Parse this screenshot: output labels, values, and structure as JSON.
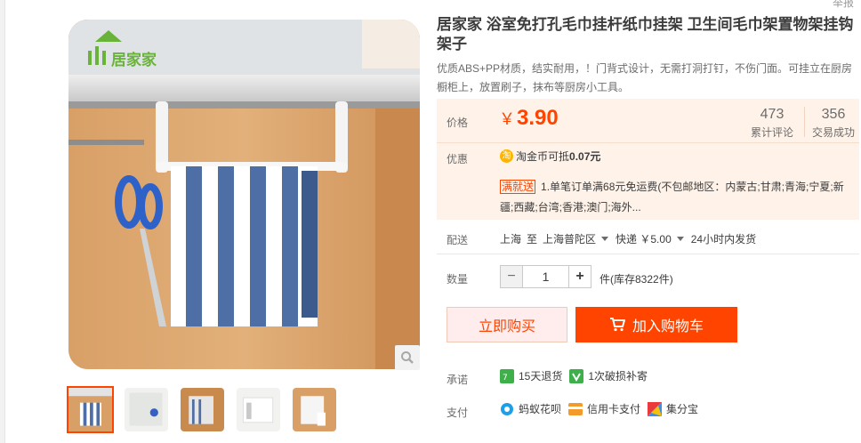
{
  "report_link": "举报",
  "gallery": {
    "logo_text": "居家家",
    "thumb_count": 5
  },
  "product": {
    "title": "居家家 浴室免打孔毛巾挂杆纸巾挂架 卫生间毛巾架置物架挂钩架子",
    "subtitle": "优质ABS+PP材质，结实耐用，！门背式设计，无需打洞打钉，不伤门面。可挂立在厨房橱柜上，放置刷子，抹布等厨房小工具。"
  },
  "price": {
    "label": "价格",
    "currency": "￥",
    "value": "3.90",
    "reviews_count": "473",
    "reviews_label": "累计评论",
    "sales_count": "356",
    "sales_label": "交易成功"
  },
  "discount": {
    "label": "优惠",
    "coin_icon_text": "淘",
    "coin_text": "淘金币可抵",
    "coin_value": "0.07元",
    "tag": "满就送",
    "mansong_text": "1.单笔订单满68元免运费(不包邮地区：内蒙古;甘肃;青海;宁夏;新疆;西藏;台湾;香港;澳门;海外..."
  },
  "shipping": {
    "label": "配送",
    "from": "上海",
    "to_word": "至",
    "to_location": "上海普陀区",
    "method": "快递 ￥5.00",
    "dispatch": "24小时内发货"
  },
  "quantity": {
    "label": "数量",
    "minus": "−",
    "value": "1",
    "plus": "+",
    "stock_text": "件(库存8322件)"
  },
  "buttons": {
    "buy_now": "立即购买",
    "add_to_cart": "加入购物车"
  },
  "promise": {
    "label": "承诺",
    "item1": "15天退货",
    "item2": "1次破损补寄"
  },
  "payment": {
    "label": "支付",
    "item1": "蚂蚁花呗",
    "item2": "信用卡支付",
    "item3": "集分宝"
  },
  "colors": {
    "accent": "#ff4400",
    "promo_bg": "#fff2e8",
    "buy_bg": "#ffeded"
  }
}
